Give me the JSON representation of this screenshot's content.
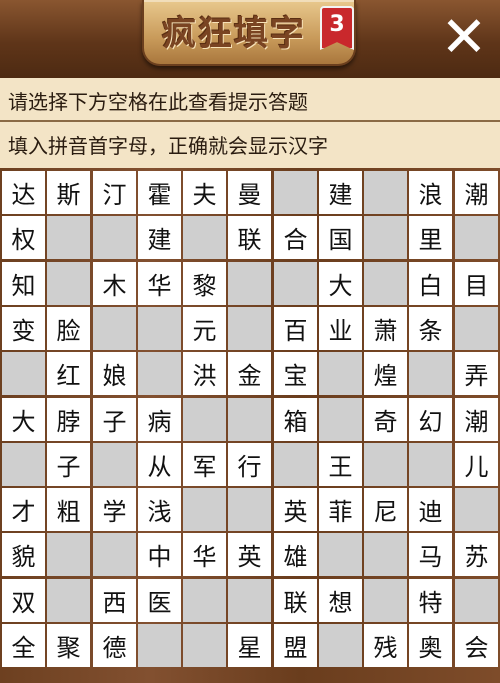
{
  "header": {
    "title": "疯狂填字",
    "level": "3",
    "close_label": "✕"
  },
  "hint": {
    "line1": "请选择下方空格在此查看提示答题",
    "line2": "填入拼音首字母，正确就会显示汉字"
  },
  "grid": {
    "rows": [
      [
        "达",
        "斯",
        "汀",
        "霍",
        "夫",
        "曼",
        "",
        "建",
        "",
        "浪",
        "潮"
      ],
      [
        "权",
        "",
        "",
        "建",
        "",
        "联",
        "合",
        "国",
        "",
        "里",
        ""
      ],
      [
        "知",
        "",
        "木",
        "华",
        "黎",
        "",
        "",
        "大",
        "",
        "白",
        "目"
      ],
      [
        "变",
        "脸",
        "",
        "",
        "元",
        "",
        "百",
        "业",
        "萧",
        "条",
        ""
      ],
      [
        "",
        "红",
        "娘",
        "",
        "洪",
        "金",
        "宝",
        "",
        "煌",
        "",
        "弄"
      ],
      [
        "大",
        "脖",
        "子",
        "病",
        "",
        "",
        "箱",
        "",
        "奇",
        "幻",
        "潮"
      ],
      [
        "",
        "子",
        "",
        "从",
        "军",
        "行",
        "",
        "王",
        "",
        "",
        "儿"
      ],
      [
        "才",
        "粗",
        "学",
        "浅",
        "",
        "",
        "英",
        "菲",
        "尼",
        "迪",
        ""
      ],
      [
        "貌",
        "",
        "",
        "中",
        "华",
        "英",
        "雄",
        "",
        "",
        "马",
        "苏"
      ],
      [
        "双",
        "",
        "西",
        "医",
        "",
        "",
        "联",
        "想",
        "",
        "特",
        ""
      ],
      [
        "全",
        "聚",
        "德",
        "",
        "",
        "星",
        "盟",
        "",
        "残",
        "奥",
        "会"
      ]
    ],
    "mask": [
      [
        1,
        1,
        1,
        1,
        1,
        1,
        0,
        1,
        0,
        1,
        1
      ],
      [
        1,
        0,
        0,
        1,
        0,
        1,
        1,
        1,
        0,
        1,
        0
      ],
      [
        1,
        0,
        1,
        1,
        1,
        0,
        0,
        1,
        0,
        1,
        1
      ],
      [
        1,
        1,
        0,
        0,
        1,
        0,
        1,
        1,
        1,
        1,
        0
      ],
      [
        0,
        1,
        1,
        0,
        1,
        1,
        1,
        0,
        1,
        0,
        1
      ],
      [
        1,
        1,
        1,
        1,
        0,
        0,
        1,
        0,
        1,
        1,
        1
      ],
      [
        0,
        1,
        0,
        1,
        1,
        1,
        0,
        1,
        0,
        0,
        1
      ],
      [
        1,
        1,
        1,
        1,
        0,
        0,
        1,
        1,
        1,
        1,
        0
      ],
      [
        1,
        0,
        0,
        1,
        1,
        1,
        1,
        0,
        0,
        1,
        1
      ],
      [
        1,
        0,
        1,
        1,
        0,
        0,
        1,
        1,
        0,
        1,
        0
      ],
      [
        1,
        1,
        1,
        0,
        0,
        1,
        1,
        0,
        1,
        1,
        1
      ]
    ]
  }
}
